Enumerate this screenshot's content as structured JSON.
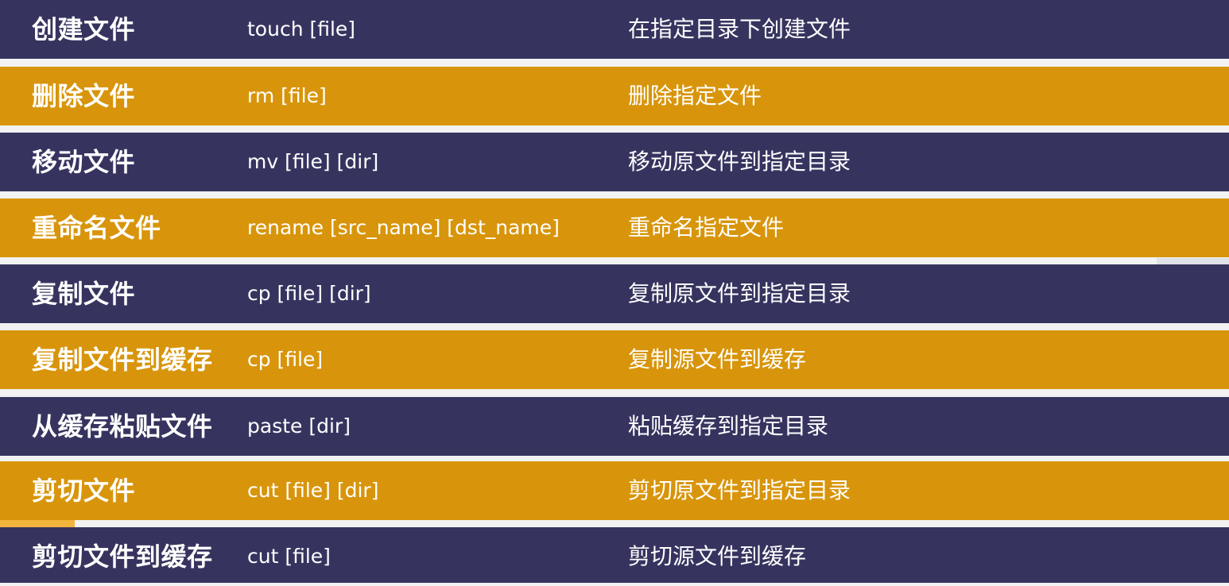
{
  "colors": {
    "navy": "#36345f",
    "gold": "#d8950b",
    "text": "#ffffff",
    "background": "#f2f2f3"
  },
  "rows": [
    {
      "name": "创建文件",
      "command": "touch [file]",
      "description": "在指定目录下创建文件"
    },
    {
      "name": "删除文件",
      "command": "rm [file]",
      "description": "删除指定文件"
    },
    {
      "name": "移动文件",
      "command": "mv [file] [dir]",
      "description": "移动原文件到指定目录"
    },
    {
      "name": "重命名文件",
      "command": "rename [src_name] [dst_name]",
      "description": "重命名指定文件"
    },
    {
      "name": "复制文件",
      "command": "cp [file] [dir]",
      "description": "复制原文件到指定目录"
    },
    {
      "name": "复制文件到缓存",
      "command": "cp [file]",
      "description": "复制源文件到缓存"
    },
    {
      "name": "从缓存粘贴文件",
      "command": "paste [dir]",
      "description": "粘贴缓存到指定目录"
    },
    {
      "name": "剪切文件",
      "command": "cut [file] [dir]",
      "description": "剪切原文件到指定目录"
    },
    {
      "name": "剪切文件到缓存",
      "command": "cut [file]",
      "description": "剪切源文件到缓存"
    }
  ]
}
